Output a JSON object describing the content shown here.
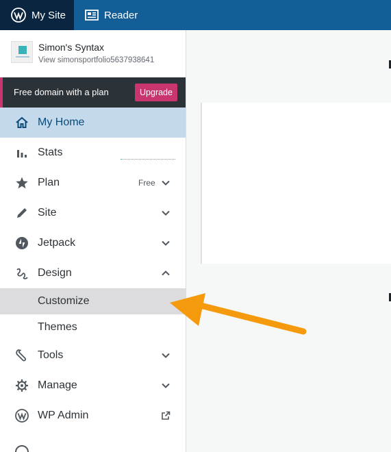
{
  "masterbar": {
    "my_site_label": "My Site",
    "reader_label": "Reader",
    "bg_color": "#135e96",
    "active_bg_color": "#0a2540"
  },
  "site": {
    "title": "Simon's Syntax",
    "view_url": "View simonsportfolio5637938641"
  },
  "upsell": {
    "text": "Free domain with a plan",
    "button_label": "Upgrade",
    "accent_color": "#c9356e"
  },
  "menu": {
    "my_home": "My Home",
    "stats": "Stats",
    "plan": "Plan",
    "plan_badge": "Free",
    "site": "Site",
    "jetpack": "Jetpack",
    "design": "Design",
    "customize": "Customize",
    "themes": "Themes",
    "tools": "Tools",
    "manage": "Manage",
    "wp_admin": "WP Admin"
  },
  "annotation": {
    "arrow_color": "#f59a0c",
    "points_to": "Customize"
  }
}
